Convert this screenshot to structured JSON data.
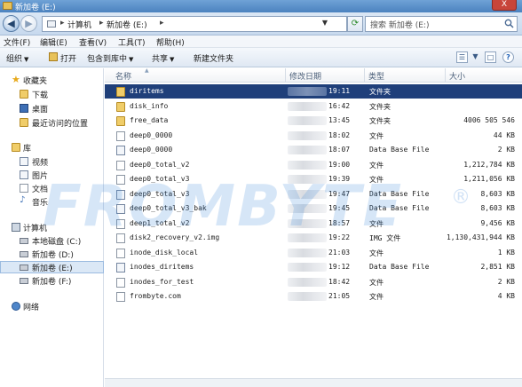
{
  "window": {
    "title": "新加卷 (E:)",
    "close_label": "X"
  },
  "address": {
    "crumbs": [
      "计算机",
      "新加卷 (E:)"
    ],
    "search_placeholder": "搜索 新加卷 (E:)"
  },
  "menu": [
    "文件(F)",
    "编辑(E)",
    "查看(V)",
    "工具(T)",
    "帮助(H)"
  ],
  "commands": {
    "organize": "组织",
    "open": "打开",
    "include": "包含到库中",
    "share": "共享",
    "new_folder": "新建文件夹"
  },
  "nav": {
    "favorites": "收藏夹",
    "downloads": "下载",
    "desktop": "桌面",
    "recent": "最近访问的位置",
    "libraries": "库",
    "videos": "视频",
    "pictures": "图片",
    "documents": "文档",
    "music": "音乐",
    "computer": "计算机",
    "drive_c": "本地磁盘 (C:)",
    "drive_d": "新加卷 (D:)",
    "drive_e": "新加卷 (E:)",
    "drive_f": "新加卷 (F:)",
    "network": "网络"
  },
  "columns": {
    "name": "名称",
    "date": "修改日期",
    "type": "类型",
    "size": "大小"
  },
  "files": [
    {
      "name": "diritems",
      "time": "19:11",
      "type": "文件夹",
      "size": "",
      "icon": "folder",
      "selected": true
    },
    {
      "name": "disk_info",
      "time": "16:42",
      "type": "文件夹",
      "size": "",
      "icon": "folder"
    },
    {
      "name": "free_data",
      "time": "13:45",
      "type": "文件夹",
      "size": "4006 505 546",
      "icon": "folder"
    },
    {
      "name": "deep0_0000",
      "time": "18:02",
      "type": "文件",
      "size": "44 KB",
      "icon": "doc"
    },
    {
      "name": "deep0_0000",
      "time": "18:07",
      "type": "Data Base File",
      "size": "2 KB",
      "icon": "doc2"
    },
    {
      "name": "deep0_total_v2",
      "time": "19:00",
      "type": "文件",
      "size": "1,212,784 KB",
      "icon": "doc"
    },
    {
      "name": "deep0_total_v3",
      "time": "19:39",
      "type": "文件",
      "size": "1,211,056 KB",
      "icon": "doc"
    },
    {
      "name": "deep0_total_v3",
      "time": "19:47",
      "type": "Data Base File",
      "size": "8,603 KB",
      "icon": "doc2"
    },
    {
      "name": "deep0_total_v3_bak",
      "time": "19:45",
      "type": "Data Base File",
      "size": "8,603 KB",
      "icon": "doc2"
    },
    {
      "name": "deep1_total_v2",
      "time": "18:57",
      "type": "文件",
      "size": "9,456 KB",
      "icon": "doc"
    },
    {
      "name": "disk2_recovery_v2.img",
      "time": "19:22",
      "type": "IMG 文件",
      "size": "1,130,431,944 KB",
      "icon": "doc"
    },
    {
      "name": "inode_disk_local",
      "time": "21:03",
      "type": "文件",
      "size": "1 KB",
      "icon": "doc"
    },
    {
      "name": "inodes_diritems",
      "time": "19:12",
      "type": "Data Base File",
      "size": "2,851 KB",
      "icon": "doc2"
    },
    {
      "name": "inodes_for_test",
      "time": "18:42",
      "type": "文件",
      "size": "2 KB",
      "icon": "doc"
    },
    {
      "name": "frombyte.com",
      "time": "21:05",
      "type": "文件",
      "size": "4 KB",
      "icon": "doc"
    }
  ],
  "watermark": "FROMBYTE",
  "watermark_mark": "®"
}
